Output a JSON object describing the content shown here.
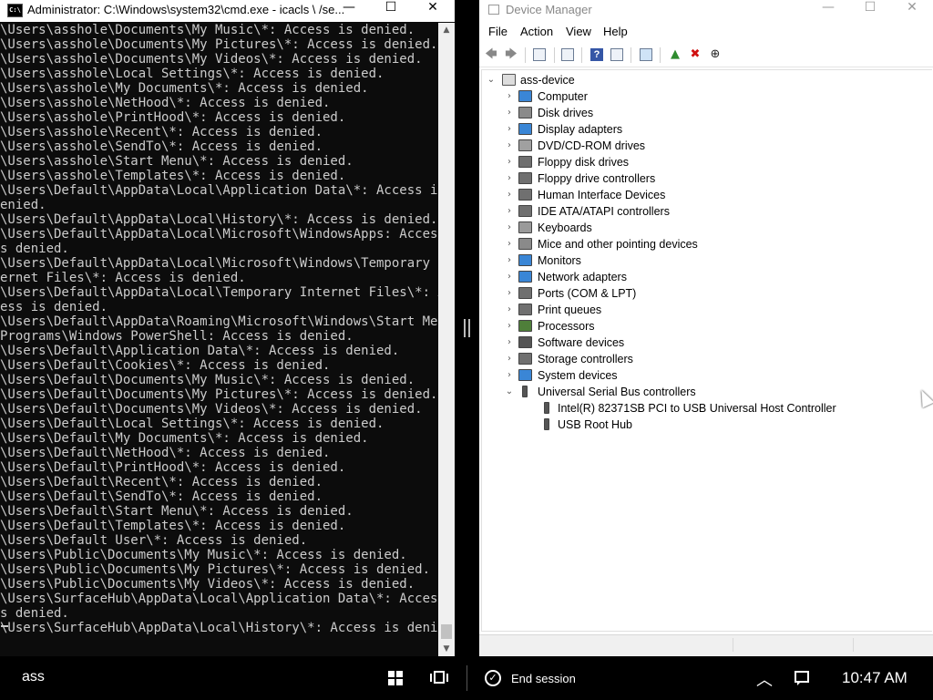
{
  "cmd": {
    "title": "Administrator: C:\\Windows\\system32\\cmd.exe - icacls  \\ /se...",
    "icon_text": "C:\\",
    "lines": [
      "\\Users\\asshole\\Documents\\My Music\\*: Access is denied.",
      "\\Users\\asshole\\Documents\\My Pictures\\*: Access is denied.",
      "\\Users\\asshole\\Documents\\My Videos\\*: Access is denied.",
      "\\Users\\asshole\\Local Settings\\*: Access is denied.",
      "\\Users\\asshole\\My Documents\\*: Access is denied.",
      "\\Users\\asshole\\NetHood\\*: Access is denied.",
      "\\Users\\asshole\\PrintHood\\*: Access is denied.",
      "\\Users\\asshole\\Recent\\*: Access is denied.",
      "\\Users\\asshole\\SendTo\\*: Access is denied.",
      "\\Users\\asshole\\Start Menu\\*: Access is denied.",
      "\\Users\\asshole\\Templates\\*: Access is denied.",
      "\\Users\\Default\\AppData\\Local\\Application Data\\*: Access is d",
      "enied.",
      "\\Users\\Default\\AppData\\Local\\History\\*: Access is denied.",
      "\\Users\\Default\\AppData\\Local\\Microsoft\\WindowsApps: Access i",
      "s denied.",
      "\\Users\\Default\\AppData\\Local\\Microsoft\\Windows\\Temporary Int",
      "ernet Files\\*: Access is denied.",
      "\\Users\\Default\\AppData\\Local\\Temporary Internet Files\\*: Acc",
      "ess is denied.",
      "\\Users\\Default\\AppData\\Roaming\\Microsoft\\Windows\\Start Menu\\",
      "Programs\\Windows PowerShell: Access is denied.",
      "\\Users\\Default\\Application Data\\*: Access is denied.",
      "\\Users\\Default\\Cookies\\*: Access is denied.",
      "\\Users\\Default\\Documents\\My Music\\*: Access is denied.",
      "\\Users\\Default\\Documents\\My Pictures\\*: Access is denied.",
      "\\Users\\Default\\Documents\\My Videos\\*: Access is denied.",
      "\\Users\\Default\\Local Settings\\*: Access is denied.",
      "\\Users\\Default\\My Documents\\*: Access is denied.",
      "\\Users\\Default\\NetHood\\*: Access is denied.",
      "\\Users\\Default\\PrintHood\\*: Access is denied.",
      "\\Users\\Default\\Recent\\*: Access is denied.",
      "\\Users\\Default\\SendTo\\*: Access is denied.",
      "\\Users\\Default\\Start Menu\\*: Access is denied.",
      "\\Users\\Default\\Templates\\*: Access is denied.",
      "\\Users\\Default User\\*: Access is denied.",
      "\\Users\\Public\\Documents\\My Music\\*: Access is denied.",
      "\\Users\\Public\\Documents\\My Pictures\\*: Access is denied.",
      "\\Users\\Public\\Documents\\My Videos\\*: Access is denied.",
      "\\Users\\SurfaceHub\\AppData\\Local\\Application Data\\*: Access i",
      "s denied.",
      "\\Users\\SurfaceHub\\AppData\\Local\\History\\*: Access is denied."
    ]
  },
  "window_controls": {
    "minimize": "—",
    "maximize": "☐",
    "close": "✕"
  },
  "device_manager": {
    "title": "Device Manager",
    "menu": [
      "File",
      "Action",
      "View",
      "Help"
    ],
    "toolbar_icons": [
      "back-arrow-icon",
      "forward-arrow-icon",
      "show-hide-console-tree-icon",
      "properties-icon",
      "help-icon",
      "action-pane-icon",
      "scan-hardware-icon",
      "update-driver-icon",
      "uninstall-icon",
      "disable-device-icon"
    ],
    "root": "ass-device",
    "categories": [
      {
        "label": "Computer",
        "icon": "computer-icon",
        "color": "#3a86d6"
      },
      {
        "label": "Disk drives",
        "icon": "disk-drive-icon",
        "color": "#8a8a8a"
      },
      {
        "label": "Display adapters",
        "icon": "display-adapter-icon",
        "color": "#3a86d6"
      },
      {
        "label": "DVD/CD-ROM drives",
        "icon": "dvd-drive-icon",
        "color": "#a0a0a0"
      },
      {
        "label": "Floppy disk drives",
        "icon": "floppy-disk-icon",
        "color": "#6f6f6f"
      },
      {
        "label": "Floppy drive controllers",
        "icon": "floppy-controller-icon",
        "color": "#6f6f6f"
      },
      {
        "label": "Human Interface Devices",
        "icon": "hid-icon",
        "color": "#707070"
      },
      {
        "label": "IDE ATA/ATAPI controllers",
        "icon": "ide-controller-icon",
        "color": "#707070"
      },
      {
        "label": "Keyboards",
        "icon": "keyboard-icon",
        "color": "#9a9a9a"
      },
      {
        "label": "Mice and other pointing devices",
        "icon": "mouse-icon",
        "color": "#8a8a8a"
      },
      {
        "label": "Monitors",
        "icon": "monitor-icon",
        "color": "#3a86d6"
      },
      {
        "label": "Network adapters",
        "icon": "network-adapter-icon",
        "color": "#3a86d6"
      },
      {
        "label": "Ports (COM & LPT)",
        "icon": "port-icon",
        "color": "#707070"
      },
      {
        "label": "Print queues",
        "icon": "printer-icon",
        "color": "#707070"
      },
      {
        "label": "Processors",
        "icon": "processor-icon",
        "color": "#4f7f3a"
      },
      {
        "label": "Software devices",
        "icon": "software-device-icon",
        "color": "#555555"
      },
      {
        "label": "Storage controllers",
        "icon": "storage-controller-icon",
        "color": "#707070"
      },
      {
        "label": "System devices",
        "icon": "system-devices-icon",
        "color": "#3a86d6"
      },
      {
        "label": "Universal Serial Bus controllers",
        "icon": "usb-icon",
        "color": "#555555",
        "expanded": true,
        "children": [
          {
            "label": "Intel(R) 82371SB PCI to USB Universal Host Controller",
            "icon": "usb-icon"
          },
          {
            "label": "USB Root Hub",
            "icon": "usb-icon"
          }
        ]
      }
    ]
  },
  "taskbar": {
    "user": "ass",
    "end_session": "End session",
    "time": "10:47 AM"
  }
}
